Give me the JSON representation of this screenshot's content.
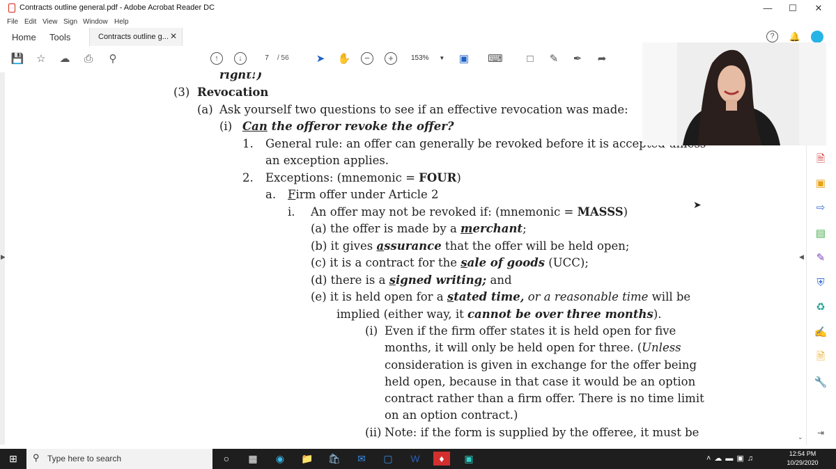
{
  "window": {
    "title": "Contracts outline general.pdf - Adobe Acrobat Reader DC",
    "controls": {
      "minimize": "—",
      "maximize": "☐",
      "close": "✕"
    }
  },
  "menu": [
    "File",
    "Edit",
    "View",
    "Sign",
    "Window",
    "Help"
  ],
  "tabs": {
    "home": "Home",
    "tools": "Tools",
    "document": "Contracts outline g...",
    "close": "✕"
  },
  "toolbar": {
    "current_page": "7",
    "page_count": "/ 56",
    "zoom": "153%"
  },
  "document": {
    "lines": [
      {
        "segments": [
          {
            "t": "right!)",
            "s": "bi"
          }
        ]
      },
      {
        "segments": [
          {
            "t": "(3)",
            "s": "n"
          }
        ]
      },
      {
        "segments": [
          {
            "t": "Revocation",
            "s": "b"
          }
        ]
      },
      {
        "segments": [
          {
            "t": "(a)",
            "s": "n"
          }
        ]
      },
      {
        "segments": [
          {
            "t": "Ask yourself two questions to see if an effective revocation was made:",
            "s": "n"
          }
        ]
      },
      {
        "segments": [
          {
            "t": "(i)",
            "s": "n"
          }
        ]
      },
      {
        "segments": [
          {
            "t": "Can",
            "s": "biu"
          },
          {
            "t": " the offeror revoke the offer?",
            "s": "bi"
          }
        ]
      },
      {
        "segments": [
          {
            "t": "1.",
            "s": "n"
          }
        ]
      },
      {
        "segments": [
          {
            "t": "General rule: an offer can generally be revoked before it is accepted unless",
            "s": "n"
          }
        ]
      },
      {
        "segments": [
          {
            "t": "an exception applies.",
            "s": "n"
          }
        ]
      },
      {
        "segments": [
          {
            "t": "2.",
            "s": "n"
          }
        ]
      },
      {
        "segments": [
          {
            "t": "Exceptions: (mnemonic = ",
            "s": "n"
          },
          {
            "t": "FOUR",
            "s": "b"
          },
          {
            "t": ")",
            "s": "n"
          }
        ]
      },
      {
        "segments": [
          {
            "t": "a.",
            "s": "n"
          }
        ]
      },
      {
        "segments": [
          {
            "t": "F",
            "s": "u"
          },
          {
            "t": "irm offer under Article 2",
            "s": "n"
          }
        ]
      },
      {
        "segments": [
          {
            "t": "i.",
            "s": "n"
          }
        ]
      },
      {
        "segments": [
          {
            "t": "An offer may not be revoked if: (mnemonic = ",
            "s": "n"
          },
          {
            "t": "MASSS",
            "s": "b"
          },
          {
            "t": ")",
            "s": "n"
          }
        ]
      },
      {
        "segments": [
          {
            "t": "(a) the offer is made by a ",
            "s": "n"
          },
          {
            "t": "m",
            "s": "biu"
          },
          {
            "t": "erchant",
            "s": "bi"
          },
          {
            "t": ";",
            "s": "n"
          }
        ]
      },
      {
        "segments": [
          {
            "t": "(b) it gives ",
            "s": "n"
          },
          {
            "t": "a",
            "s": "biu"
          },
          {
            "t": "ssurance",
            "s": "bi"
          },
          {
            "t": " that the offer will be held open;",
            "s": "n"
          }
        ]
      },
      {
        "segments": [
          {
            "t": "(c) it is a contract for the ",
            "s": "n"
          },
          {
            "t": "s",
            "s": "biu"
          },
          {
            "t": "ale of goods",
            "s": "bi"
          },
          {
            "t": " (UCC);",
            "s": "n"
          }
        ]
      },
      {
        "segments": [
          {
            "t": "(d) there is a ",
            "s": "n"
          },
          {
            "t": "s",
            "s": "biu"
          },
          {
            "t": "igned writing;",
            "s": "bi"
          },
          {
            "t": " and",
            "s": "n"
          }
        ]
      },
      {
        "segments": [
          {
            "t": "(e) it is held open for a ",
            "s": "n"
          },
          {
            "t": "s",
            "s": "biu"
          },
          {
            "t": "tated time,",
            "s": "bi"
          },
          {
            "t": " or a reasonable time",
            "s": "i"
          },
          {
            "t": " will be",
            "s": "n"
          }
        ]
      },
      {
        "segments": [
          {
            "t": "implied (either way, it ",
            "s": "n"
          },
          {
            "t": "cannot be over three months",
            "s": "bi"
          },
          {
            "t": ").",
            "s": "n"
          }
        ]
      },
      {
        "segments": [
          {
            "t": "(i)",
            "s": "n"
          }
        ]
      },
      {
        "segments": [
          {
            "t": "Even if the firm offer states it is held open for five",
            "s": "n"
          }
        ]
      },
      {
        "segments": [
          {
            "t": "months, it will only be held open for three. (",
            "s": "n"
          },
          {
            "t": "Unless",
            "s": "i"
          }
        ]
      },
      {
        "segments": [
          {
            "t": "consideration is given in exchange for the offer being",
            "s": "n"
          }
        ]
      },
      {
        "segments": [
          {
            "t": "held open, because in that case it would be an option",
            "s": "n"
          }
        ]
      },
      {
        "segments": [
          {
            "t": "contract rather than a firm offer. There is no time limit",
            "s": "n"
          }
        ]
      },
      {
        "segments": [
          {
            "t": "on an option contract.)",
            "s": "n"
          }
        ]
      },
      {
        "segments": [
          {
            "t": "(ii)",
            "s": "n"
          }
        ]
      },
      {
        "segments": [
          {
            "t": "Note: if the form is supplied by the offeree, it must be",
            "s": "n"
          }
        ]
      }
    ]
  },
  "taskbar": {
    "search_placeholder": "Type here to search",
    "time": "12:54 PM",
    "date": "10/29/2020"
  },
  "colors": {
    "accent": "#d32f2f",
    "taskbar": "#1e1e1e",
    "cursor_blue": "#1f63c6"
  }
}
